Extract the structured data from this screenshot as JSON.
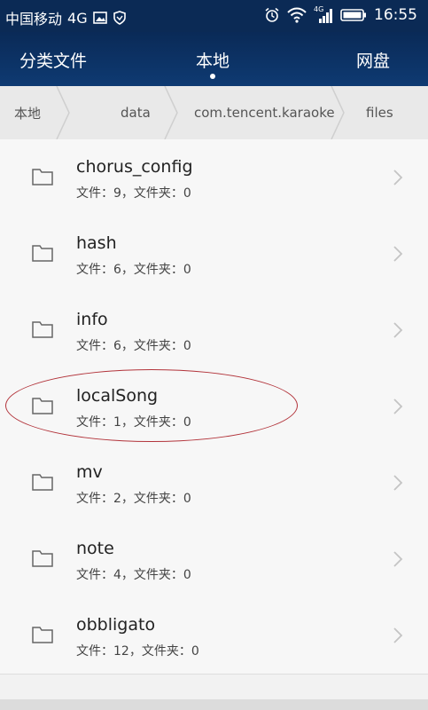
{
  "status": {
    "carrier": "中国移动",
    "network": "4G",
    "signal_label": "4G",
    "time": "16:55",
    "icons": [
      "image-icon",
      "shield-icon",
      "alarm-icon",
      "wifi-icon",
      "signal-icon",
      "battery-icon"
    ]
  },
  "tabs": [
    "分类文件",
    "本地",
    "网盘"
  ],
  "breadcrumb": [
    "本地",
    "data",
    "com.tencent.karaoke",
    "files"
  ],
  "files": [
    {
      "name": "chorus_config",
      "meta": "文件：9，文件夹：0"
    },
    {
      "name": "hash",
      "meta": "文件：6，文件夹：0"
    },
    {
      "name": "info",
      "meta": "文件：6，文件夹：0"
    },
    {
      "name": "localSong",
      "meta": "文件：1，文件夹：0"
    },
    {
      "name": "mv",
      "meta": "文件：2，文件夹：0"
    },
    {
      "name": "note",
      "meta": "文件：4，文件夹：0"
    },
    {
      "name": "obbligato",
      "meta": "文件：12，文件夹：0"
    }
  ],
  "colors": {
    "header": "#0b2a55",
    "highlight": "#b2333a"
  }
}
